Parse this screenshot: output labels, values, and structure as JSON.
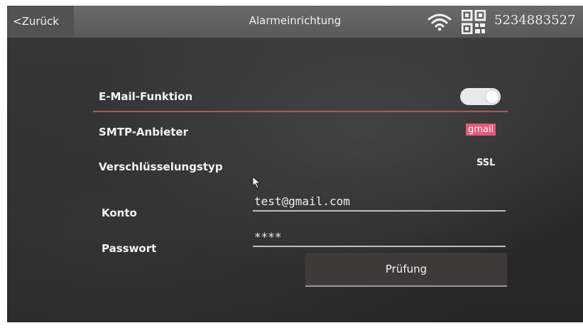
{
  "header": {
    "back_label": "<Zurück",
    "title": "Alarmeinrichtung",
    "device_id": "5234883527",
    "icons": [
      "wifi-icon",
      "qr-code-icon"
    ]
  },
  "settings": {
    "email_function": {
      "label": "E-Mail-Funktion",
      "enabled": true
    },
    "smtp_provider": {
      "label": "SMTP-Anbieter",
      "value": "gmail"
    },
    "encryption_type": {
      "label": "Verschlüsselungstyp",
      "value": "SSL"
    },
    "account": {
      "label": "Konto",
      "value": "test@gmail.com"
    },
    "password": {
      "label": "Passwort",
      "value": "****"
    }
  },
  "actions": {
    "check_label": "Prüfung"
  },
  "colors": {
    "accent_line": "#d9434a",
    "highlight": "#e05a7b"
  }
}
